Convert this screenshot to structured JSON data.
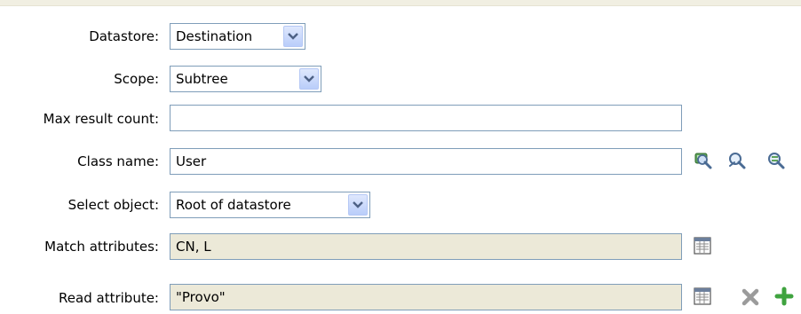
{
  "form": {
    "datastore": {
      "label": "Datastore:",
      "value": "Destination"
    },
    "scope": {
      "label": "Scope:",
      "value": "Subtree"
    },
    "max_result_count": {
      "label": "Max result count:",
      "value": ""
    },
    "class_name": {
      "label": "Class name:",
      "value": "User"
    },
    "select_object": {
      "label": "Select object:",
      "value": "Root of datastore"
    },
    "match_attributes": {
      "label": "Match attributes:",
      "value": "CN, L"
    },
    "read_attribute": {
      "label": "Read attribute:",
      "value": "\"Provo\""
    }
  },
  "icons": {
    "class_name": [
      "browse-schema-icon",
      "find-class-icon",
      "select-class-icon"
    ],
    "match_attributes": [
      "list-editor-icon"
    ],
    "read_attribute": [
      "list-editor-icon",
      "delete-icon",
      "add-icon"
    ]
  },
  "colors": {
    "field_border": "#7f9db9",
    "readonly_bg": "#ece9d8",
    "add_green": "#3fa33f",
    "delete_gray": "#9b9b9b"
  }
}
